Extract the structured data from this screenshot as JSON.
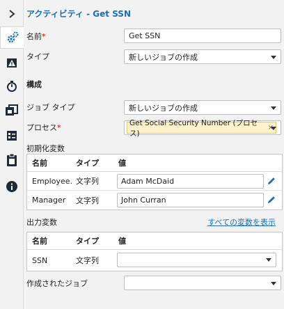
{
  "rail": {
    "items": [
      {
        "name": "collapse-icon",
        "glyph": "chevron"
      },
      {
        "name": "gear-icon",
        "active": true
      },
      {
        "name": "alert-icon"
      },
      {
        "name": "timer-icon"
      },
      {
        "name": "book-icon"
      },
      {
        "name": "checklist-icon"
      },
      {
        "name": "clipboard-icon"
      },
      {
        "name": "info-icon"
      }
    ]
  },
  "header": {
    "title": "アクティビティ - Get SSN"
  },
  "form": {
    "name_label": "名前",
    "name_required": "*",
    "name_value": "Get SSN",
    "type_label": "タイプ",
    "type_value": "新しいジョブの作成"
  },
  "config": {
    "section_title": "構成",
    "job_type_label": "ジョブ タイプ",
    "job_type_value": "新しいジョブの作成",
    "process_label": "プロセス",
    "process_required": "*",
    "process_chip": "Get Social Security Number (プロセス)",
    "process_chip_remove": "×"
  },
  "init_vars": {
    "section_title": "初期化変数",
    "headers": {
      "name": "名前",
      "type": "タイプ",
      "value": "値"
    },
    "rows": [
      {
        "name": "Employee...",
        "type": "文字列",
        "value": "Adam McDaid"
      },
      {
        "name": "Manager",
        "type": "文字列",
        "value": "John Curran"
      }
    ]
  },
  "output_vars": {
    "section_title": "出力変数",
    "show_all_link": "すべての変数を表示",
    "headers": {
      "name": "名前",
      "type": "タイプ",
      "value": "値"
    },
    "rows": [
      {
        "name": "SSN",
        "type": "文字列",
        "value": ""
      }
    ]
  },
  "created_job": {
    "label": "作成されたジョブ",
    "value": ""
  },
  "colors": {
    "accent": "#1a6fb5",
    "required": "#cc0000",
    "chip_bg": "#fff2cc"
  }
}
